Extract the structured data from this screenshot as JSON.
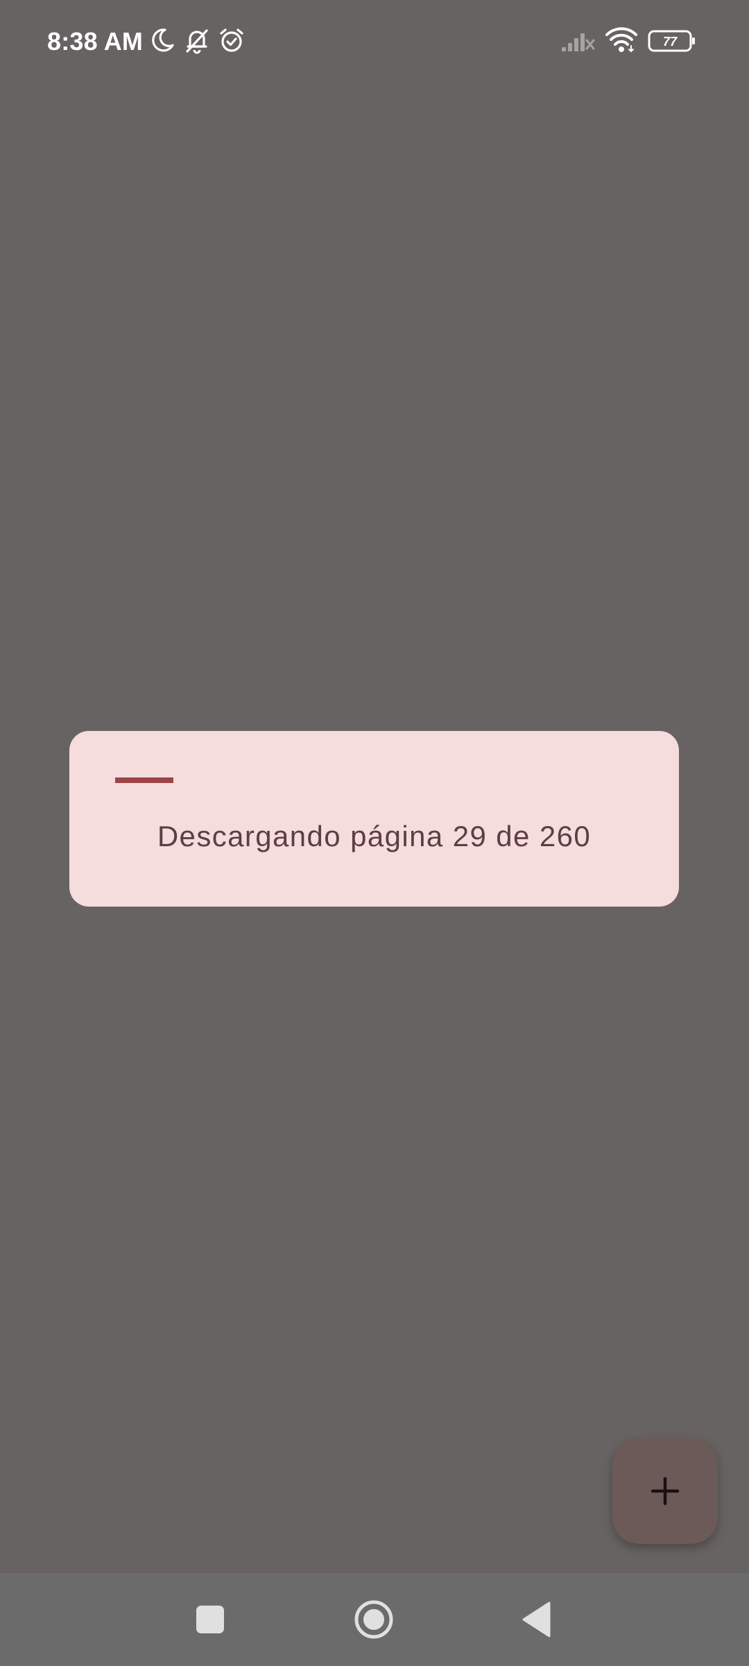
{
  "status_bar": {
    "time": "8:38 AM",
    "battery_level": "77",
    "icons": [
      "moon-icon",
      "bell-off-icon",
      "alarm-icon",
      "signal-icon",
      "wifi-icon",
      "battery-icon"
    ]
  },
  "dialog": {
    "message": "Descargando página 29 de 260",
    "progress": {
      "current_page": 29,
      "total_pages": 260
    }
  },
  "fab": {
    "icon": "plus-icon"
  },
  "navigation": {
    "items": [
      "recents-button",
      "home-button",
      "back-button"
    ]
  },
  "colors": {
    "background": "#676362",
    "dialog": "#f5dcdd",
    "accent": "#9e4447",
    "message_text": "#5b3f42",
    "fab": "#6c5a59",
    "nav_bar": "#6b6b6b"
  }
}
